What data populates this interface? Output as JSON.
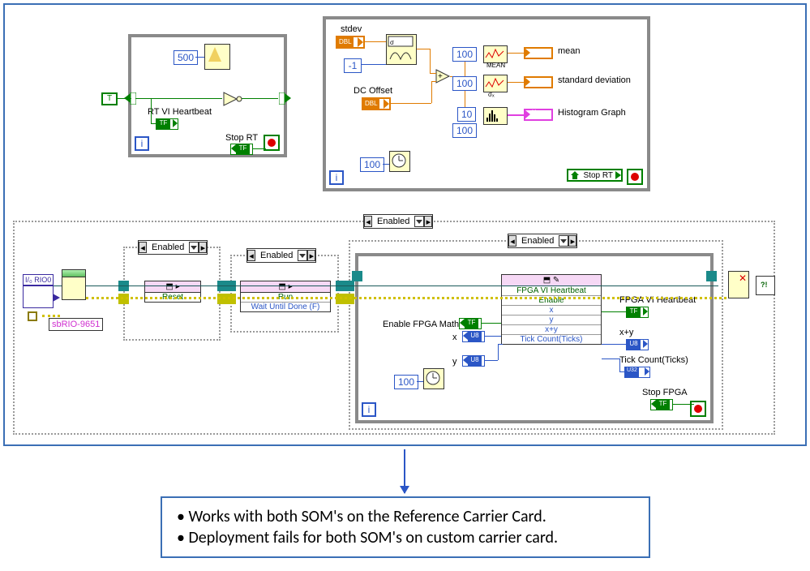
{
  "loop1": {
    "metronome_ms": "500",
    "heartbeat_label": "RT VI Heartbeat",
    "stop_label": "Stop RT",
    "bool_const": "T"
  },
  "loop2": {
    "stdev_label": "stdev",
    "init_const": "-1",
    "dc_offset_label": "DC Offset",
    "const_100_a": "100",
    "const_100_b": "100",
    "const_10": "10",
    "const_100_c": "100",
    "wait_ms": "100",
    "mean_label": "mean",
    "stddev_label": "standard deviation",
    "histogram_label": "Histogram Graph",
    "stop_local": "Stop RT"
  },
  "fpga": {
    "rio_tag": "I/₀ RIO0",
    "sbrio_label": "sbRIO-9651",
    "sel_enabled": "Enabled",
    "reset_method": "Reset",
    "run_method": "Run",
    "run_arg": "Wait Until Done (F)",
    "rw_header": "",
    "rw_rows": [
      "FPGA VI Heartbeat",
      "Enable",
      "x",
      "y",
      "x+y",
      "Tick Count(Ticks)"
    ],
    "enable_label": "Enable FPGA Math",
    "x_label": "x",
    "y_label": "y",
    "wait_inner": "100",
    "out_heartbeat": "FPGA VI Heartbeat",
    "out_xy": "x+y",
    "out_ticks": "Tick Count(Ticks)",
    "stop_fpga": "Stop FPGA"
  },
  "note": {
    "line1": "Works with both SOM's on the Reference Carrier Card.",
    "line2": "Deployment fails for both SOM's on custom carrier card."
  },
  "chart_data": {
    "type": "table",
    "description": "LabVIEW RT block diagram with three loops and FPGA host interaction",
    "loops": [
      {
        "kind": "while",
        "elements": [
          "Wait(500ms)",
          "RT VI Heartbeat (NOT toggle)",
          "Stop RT"
        ]
      },
      {
        "kind": "for",
        "N": 100,
        "elements": [
          "Gaussian White Noise(stdev, seed=-1)",
          "+ DC Offset",
          "Mean(N=100)",
          "StdDev(N=100)",
          "Histogram(bins=10, N=100)",
          "Stop RT local read"
        ]
      },
      {
        "kind": "host-fpga",
        "sequence": [
          "Open FPGA VI Reference(sbRIO-9651, RIO0)",
          "[Enabled] Reset",
          "[Enabled] Run(Wait Until Done=F)",
          "[Enabled] While{ Read/Write Control: FPGA VI Heartbeat, Enable, x, y, x+y, Tick Count(Ticks); Wait(100ms); Stop FPGA }",
          "Close FPGA Reference",
          "Simple Error Handler"
        ]
      }
    ]
  }
}
